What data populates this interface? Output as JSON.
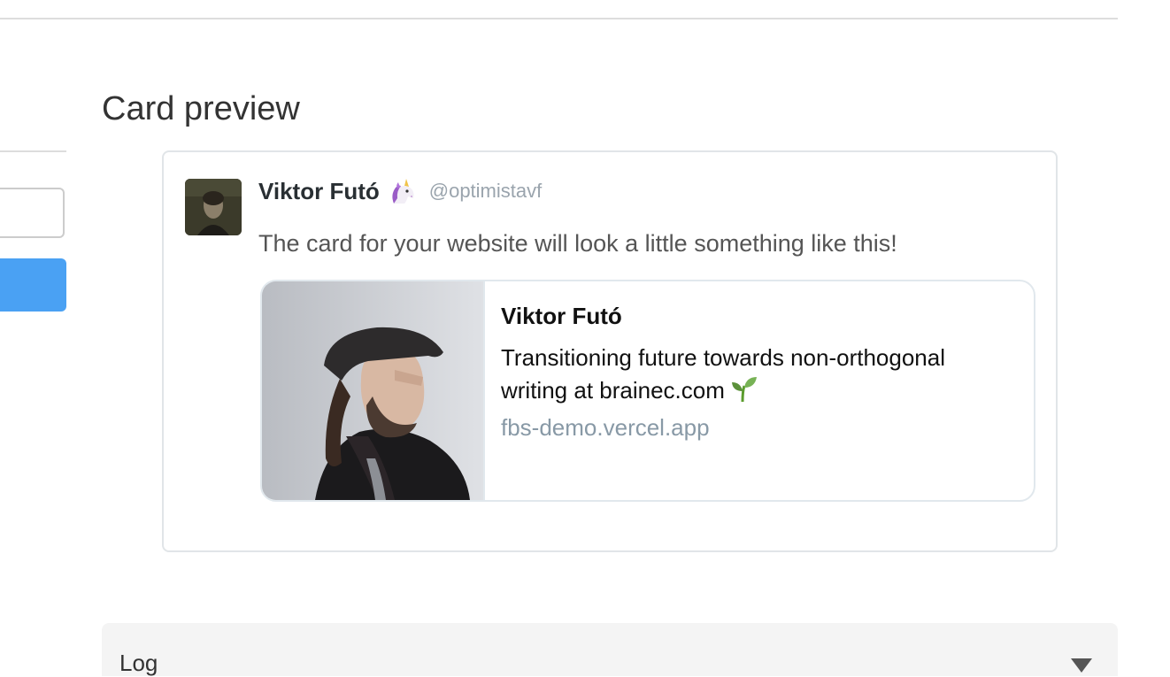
{
  "section": {
    "title": "Card preview"
  },
  "tweet": {
    "author_name": "Viktor Futó",
    "author_emoji": "unicorn-icon",
    "handle": "@optimistavf",
    "text": "The card for your website will look a little something like this!"
  },
  "card": {
    "title": "Viktor Futó",
    "description": "Transitioning future towards non-orthogonal writing at brainec.com",
    "description_emoji": "sprout-icon",
    "domain": "fbs-demo.vercel.app"
  },
  "log": {
    "label": "Log",
    "toggle_icon": "triangle-down-icon"
  },
  "colors": {
    "primary_button": "#4aa1f3",
    "handle_gray": "#9aa4ad",
    "domain_gray": "#8899a6",
    "border": "#e1e8ed"
  }
}
